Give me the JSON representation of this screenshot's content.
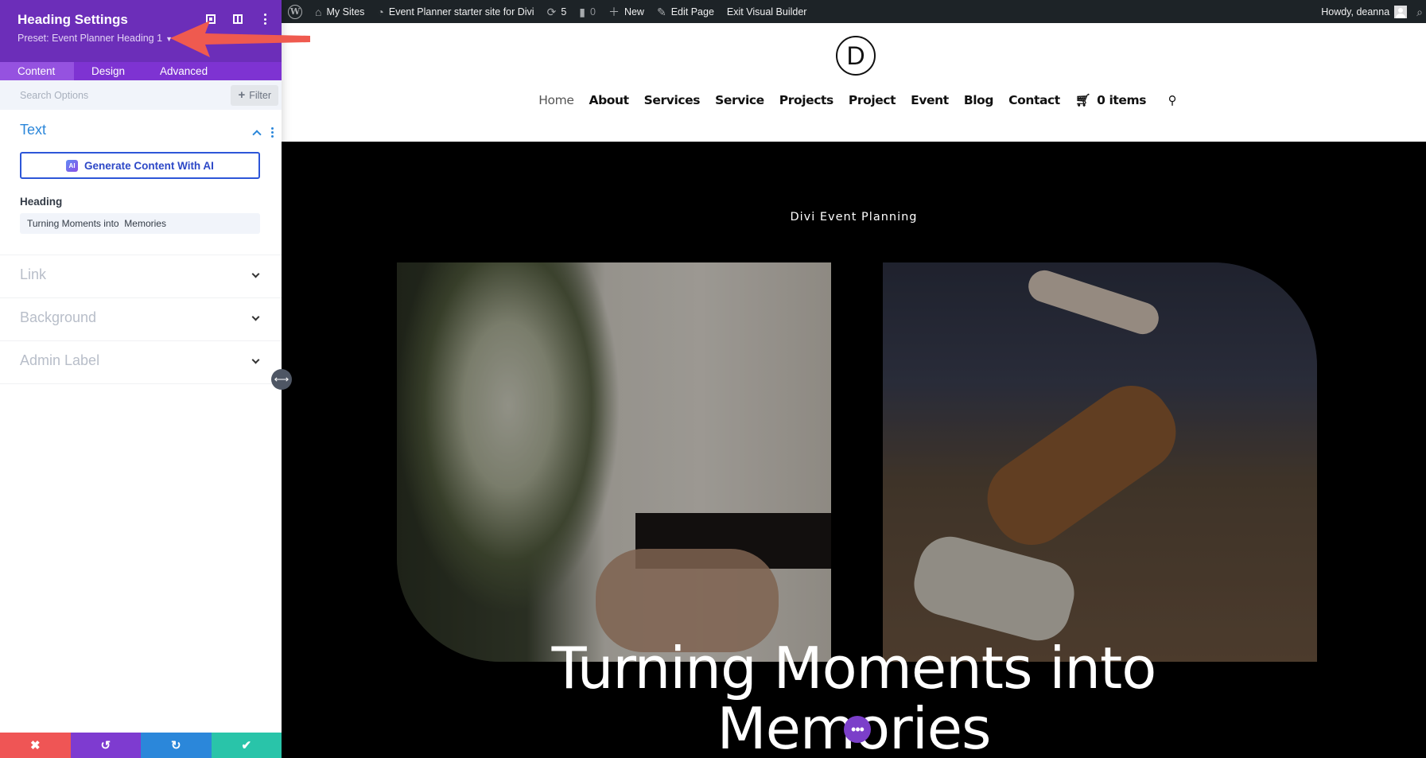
{
  "admin_bar": {
    "my_sites": "My Sites",
    "site_name": "Event Planner starter site for Divi",
    "updates_count": "5",
    "comments_count": "0",
    "new_label": "New",
    "edit_page": "Edit Page",
    "exit_builder": "Exit Visual Builder",
    "howdy": "Howdy, deanna"
  },
  "site": {
    "logo_letter": "D",
    "nav": [
      "Home",
      "About",
      "Services",
      "Service",
      "Projects",
      "Project",
      "Event",
      "Blog",
      "Contact"
    ],
    "cart_label": "0 items",
    "eyebrow": "Divi Event Planning",
    "hero_title_line1": "Turning Moments into",
    "hero_title_line2": "Memories",
    "dots_label": "•••"
  },
  "panel": {
    "title": "Heading Settings",
    "preset": "Preset: Event Planner Heading 1",
    "tabs": [
      "Content",
      "Design",
      "Advanced"
    ],
    "active_tab": "Content",
    "search_placeholder": "Search Options",
    "filter_label": "Filter",
    "sections": {
      "text": {
        "title": "Text",
        "ai_button": "Generate Content With AI",
        "ai_badge": "AI",
        "heading_label": "Heading",
        "heading_value": "Turning Moments into  Memories"
      },
      "link": "Link",
      "background": "Background",
      "admin_label": "Admin Label"
    },
    "bottom_bar": {
      "cancel": "✖",
      "undo": "↺",
      "redo": "↻",
      "save": "✔"
    }
  },
  "colors": {
    "panel_header": "#6c2eb9",
    "accent_blue": "#2b87da",
    "cancel": "#ef5555",
    "undo": "#7e3bd0",
    "redo": "#2b87da",
    "save": "#29c4a9",
    "annotation_arrow": "#ef5a4f"
  }
}
